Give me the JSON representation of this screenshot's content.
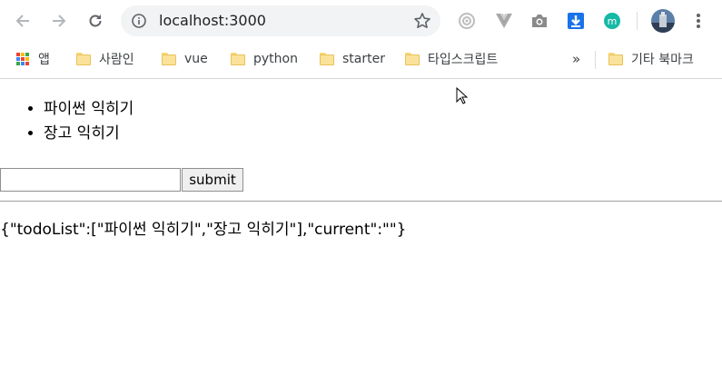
{
  "browser": {
    "url": "localhost:3000",
    "icons": {
      "back": "back-arrow-icon",
      "forward": "forward-arrow-icon",
      "reload": "reload-icon",
      "info": "info-icon",
      "star": "star-icon",
      "menu": "kebab-menu-icon"
    },
    "extensions": [
      "record-extension-icon",
      "vue-devtools-icon",
      "camera-extension-icon",
      "download-extension-icon",
      "m-extension-icon"
    ],
    "profile_avatar": "profile-avatar"
  },
  "bookmarks": {
    "apps_label": "앱",
    "items": [
      "사람인",
      "vue",
      "python",
      "starter",
      "타입스크립트"
    ],
    "overflow_label": "»",
    "other_label": "기타 북마크"
  },
  "page": {
    "todos": [
      "파이썬 익히기",
      "장고 익히기"
    ],
    "input_value": "",
    "submit_label": "submit",
    "state_json": "{\"todoList\":[\"파이썬 익히기\",\"장고 익히기\"],\"current\":\"\"}"
  },
  "colors": {
    "omnibox_bg": "#f1f3f4",
    "folder": "#fbe29b",
    "vue_green": "#41b883",
    "download_blue": "#1a73e8",
    "m_teal": "#16b9a6"
  }
}
